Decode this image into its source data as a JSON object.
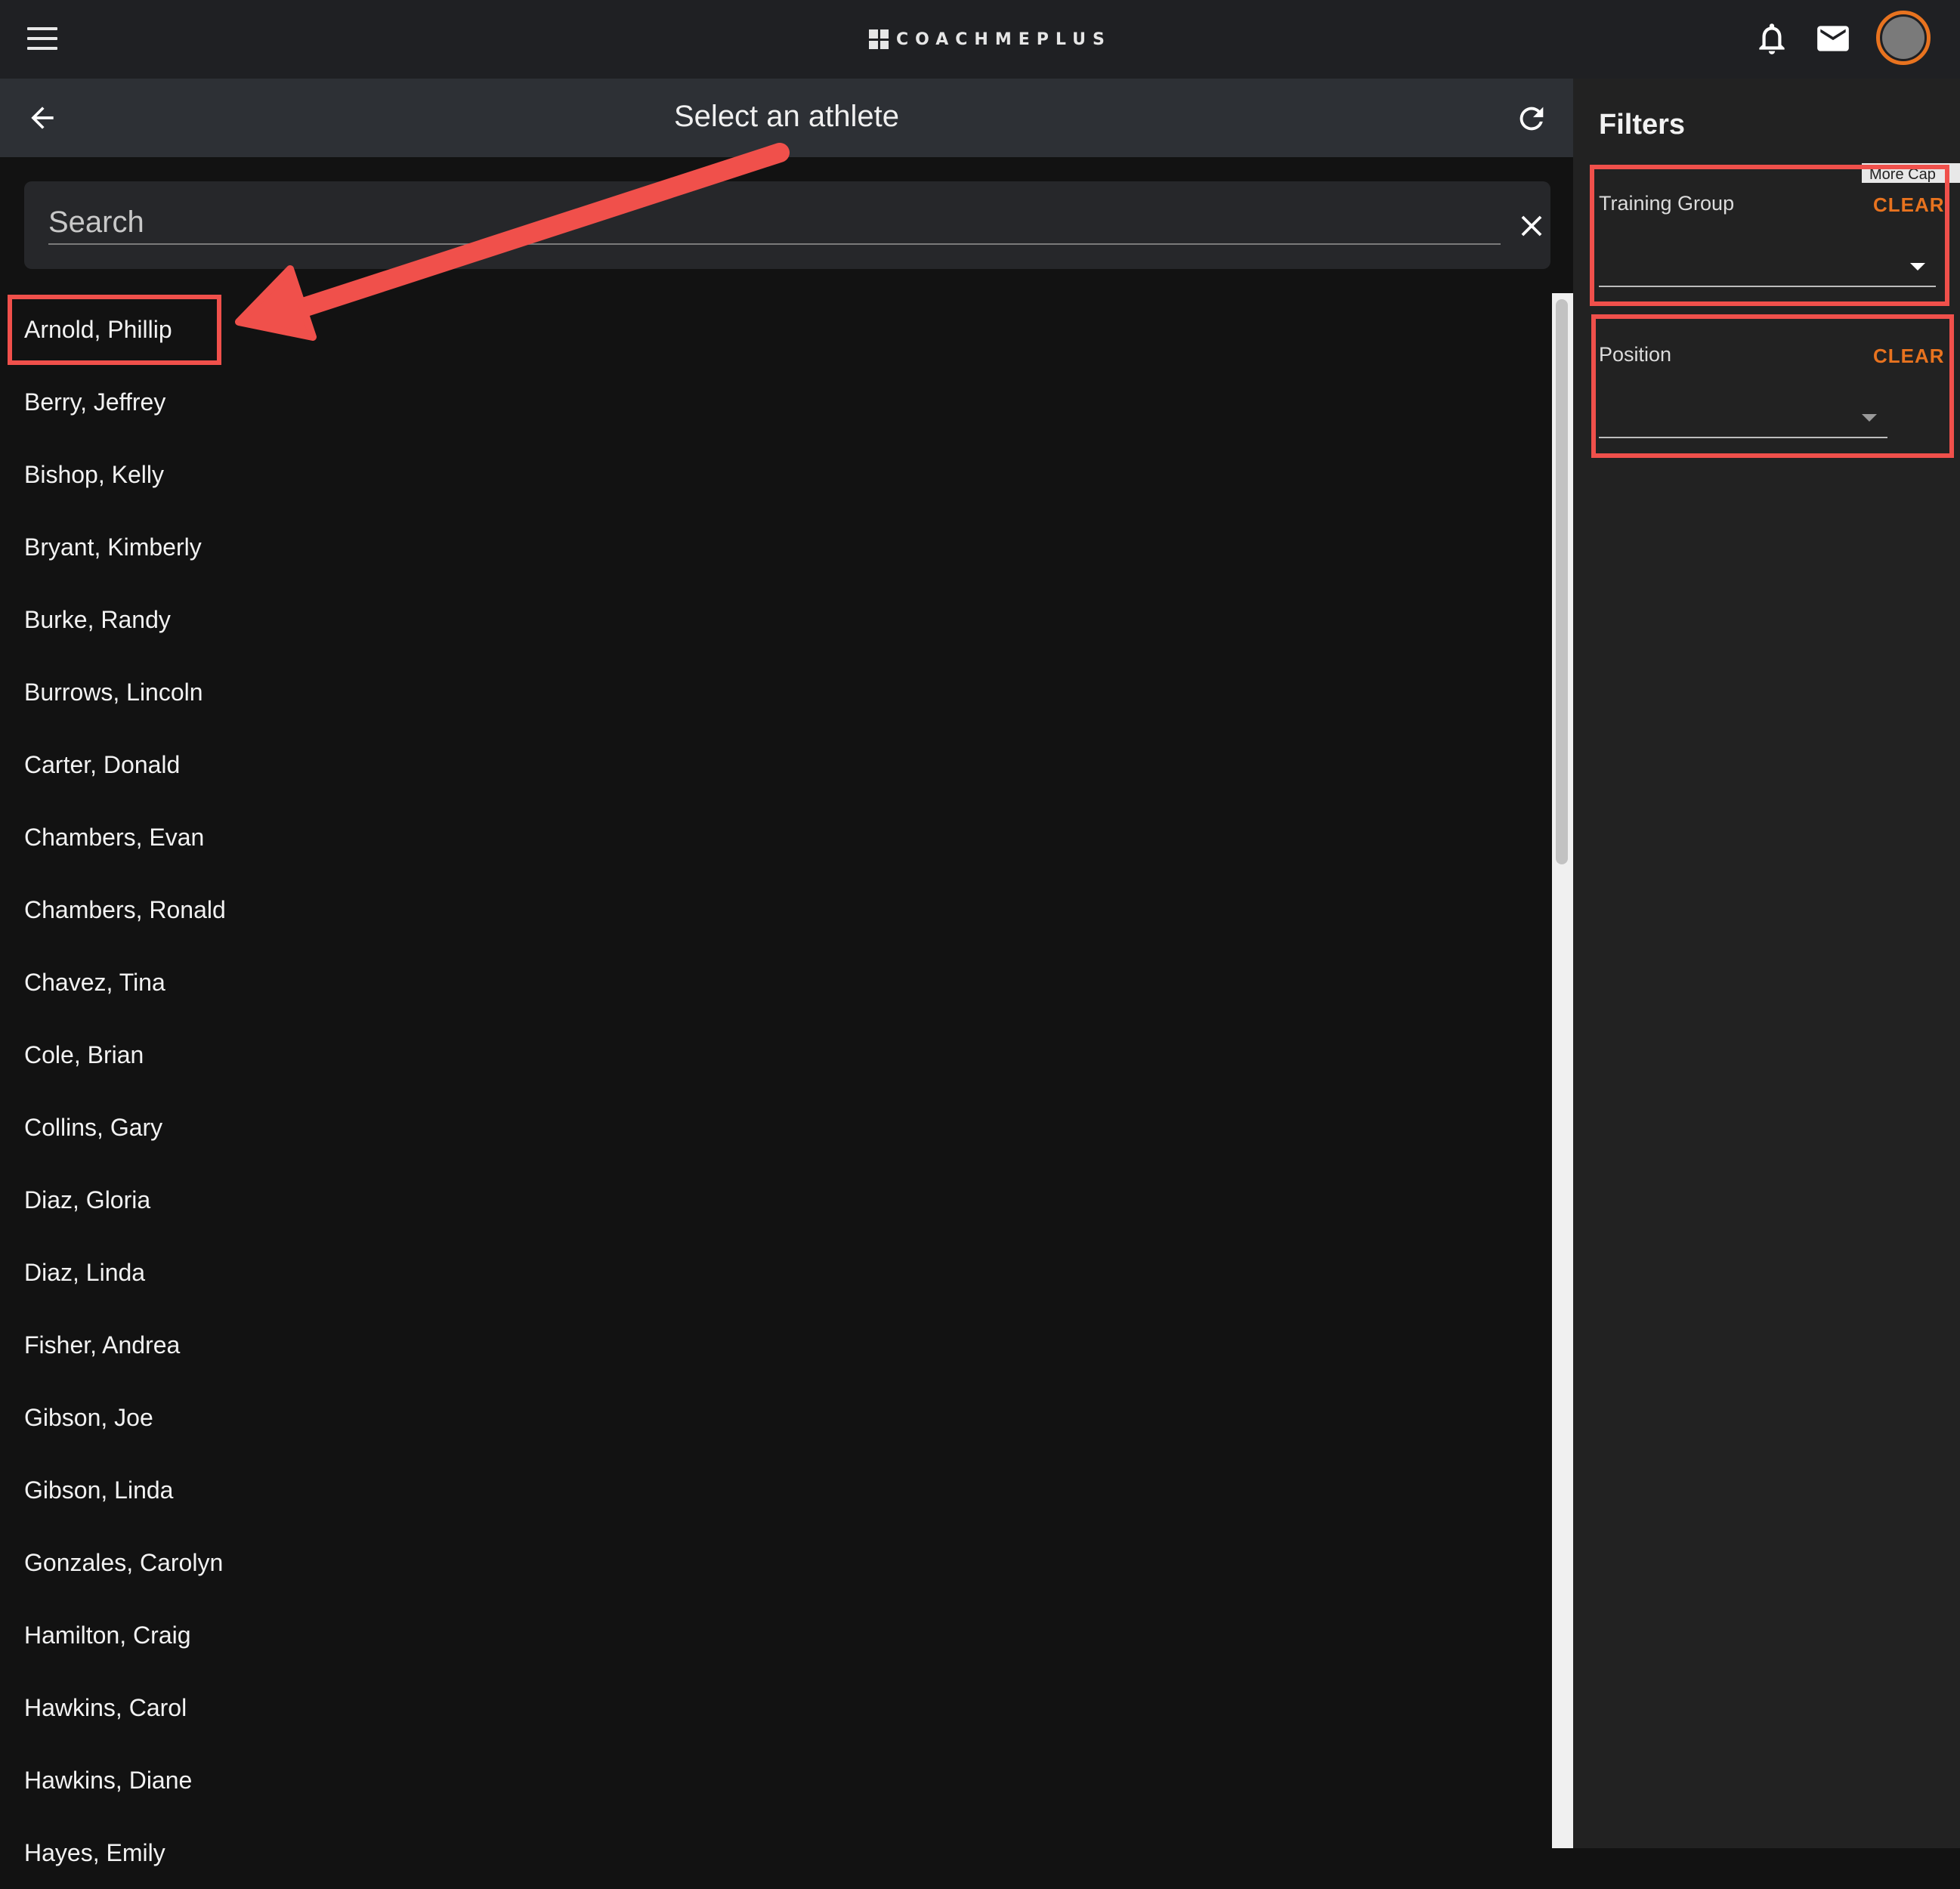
{
  "app": {
    "logo_text": "COACHMEPLUS",
    "accent_color": "#e8731f",
    "icons": [
      "menu-icon",
      "bell-icon",
      "mail-icon",
      "avatar"
    ]
  },
  "header": {
    "title": "Select an athlete",
    "back_icon": "arrow-left-icon",
    "refresh_icon": "refresh-icon"
  },
  "search": {
    "placeholder": "Search",
    "value": "",
    "clear_icon": "close-icon"
  },
  "athletes": [
    "Arnold, Phillip",
    "Berry, Jeffrey",
    "Bishop, Kelly",
    "Bryant, Kimberly",
    "Burke, Randy",
    "Burrows, Lincoln",
    "Carter, Donald",
    "Chambers, Evan",
    "Chambers, Ronald",
    "Chavez, Tina",
    "Cole, Brian",
    "Collins, Gary",
    "Diaz, Gloria",
    "Diaz, Linda",
    "Fisher, Andrea",
    "Gibson, Joe",
    "Gibson, Linda",
    "Gonzales, Carolyn",
    "Hamilton, Craig",
    "Hawkins, Carol",
    "Hawkins, Diane",
    "Hayes, Emily"
  ],
  "filters": {
    "title": "Filters",
    "tooltip": "More Cap",
    "training_group": {
      "label": "Training Group",
      "clear": "CLEAR",
      "value": ""
    },
    "position": {
      "label": "Position",
      "clear": "CLEAR",
      "value": ""
    }
  },
  "annotation_color": "#f0504b"
}
